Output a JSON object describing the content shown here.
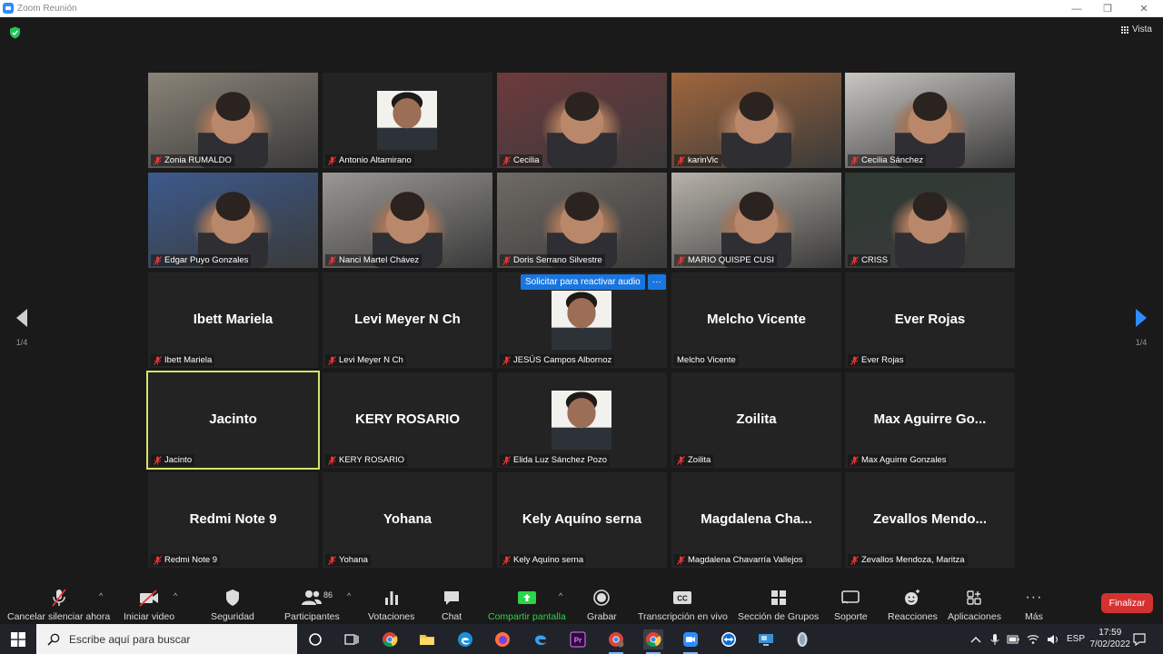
{
  "window": {
    "title": "Zoom Reunión",
    "minimize": "—",
    "maximize": "❐",
    "close": "✕"
  },
  "header": {
    "view_label": "Vista"
  },
  "pager": {
    "left_label": "1/4",
    "right_label": "1/4"
  },
  "reactivate_audio": {
    "label": "Solicitar para reactivar audio",
    "more": "···"
  },
  "tiles": [
    {
      "name": "Zonia RUMALDO",
      "big": "",
      "kind": "video",
      "muted": true,
      "bg": "#8a8478"
    },
    {
      "name": "Antonio Altamirano",
      "big": "",
      "kind": "photo",
      "muted": true,
      "bg": "#232323"
    },
    {
      "name": "Cecilia",
      "big": "",
      "kind": "video",
      "muted": true,
      "bg": "#6e3a3d"
    },
    {
      "name": "karinVic",
      "big": "",
      "kind": "video",
      "muted": true,
      "bg": "#a0663c"
    },
    {
      "name": "Cecilia Sánchez",
      "big": "",
      "kind": "video",
      "muted": true,
      "bg": "#c9c6c2"
    },
    {
      "name": "Edgar Puyo Gonzales",
      "big": "",
      "kind": "video",
      "muted": true,
      "bg": "#3c5a8c"
    },
    {
      "name": "Nanci Martel Chávez",
      "big": "",
      "kind": "video",
      "muted": true,
      "bg": "#9a9894"
    },
    {
      "name": "Doris Serrano Silvestre",
      "big": "",
      "kind": "video",
      "muted": true,
      "bg": "#6f6a64"
    },
    {
      "name": "MARIO QUISPE CUSI",
      "big": "",
      "kind": "video",
      "muted": true,
      "bg": "#b7b2aa"
    },
    {
      "name": "CRISS",
      "big": "",
      "kind": "video",
      "muted": true,
      "bg": "#2f3a34"
    },
    {
      "name": "Ibett Mariela",
      "big": "Ibett Mariela",
      "kind": "name",
      "muted": true
    },
    {
      "name": "Levi Meyer N Ch",
      "big": "Levi Meyer N Ch",
      "kind": "name",
      "muted": true
    },
    {
      "name": "JESÚS Campos Albornoz",
      "big": "",
      "kind": "photo",
      "muted": true
    },
    {
      "name": "Melcho Vicente",
      "big": "Melcho Vicente",
      "kind": "name",
      "muted": false
    },
    {
      "name": "Ever Rojas",
      "big": "Ever Rojas",
      "kind": "name",
      "muted": true
    },
    {
      "name": "Jacinto",
      "big": "Jacinto",
      "kind": "name",
      "muted": true,
      "active": true
    },
    {
      "name": "KERY ROSARIO",
      "big": "KERY ROSARIO",
      "kind": "name",
      "muted": true
    },
    {
      "name": "Elida Luz Sánchez Pozo",
      "big": "",
      "kind": "photo",
      "muted": true
    },
    {
      "name": "Zoilita",
      "big": "Zoilita",
      "kind": "name",
      "muted": true
    },
    {
      "name": "Max Aguirre Gonzales",
      "big": "Max Aguirre Go...",
      "kind": "name",
      "muted": true
    },
    {
      "name": "Redmi Note 9",
      "big": "Redmi Note 9",
      "kind": "name",
      "muted": true
    },
    {
      "name": "Yohana",
      "big": "Yohana",
      "kind": "name",
      "muted": true
    },
    {
      "name": "Kely Aquíno serna",
      "big": "Kely Aquíno serna",
      "kind": "name",
      "muted": true
    },
    {
      "name": "Magdalena Chavarría Vallejos",
      "big": "Magdalena  Cha...",
      "kind": "name",
      "muted": true
    },
    {
      "name": "Zevallos Mendoza, Maritza",
      "big": "Zevallos  Mendo...",
      "kind": "name",
      "muted": true
    }
  ],
  "toolbar": {
    "unmute": "Cancelar silenciar ahora",
    "video": "Iniciar video",
    "security": "Seguridad",
    "participants": "Participantes",
    "participants_count": "86",
    "polls": "Votaciones",
    "chat": "Chat",
    "share": "Compartir pantalla",
    "record": "Grabar",
    "transcription": "Transcripción en vivo",
    "breakout": "Sección de Grupos",
    "support": "Soporte",
    "reactions": "Reacciones",
    "apps": "Aplicaciones",
    "more": "Más",
    "end": "Finalizar",
    "caret": "^",
    "cc": "CC",
    "more_dots": "···",
    "share_color": "#2bd44a",
    "end_color": "#d63131"
  },
  "taskbar": {
    "search_placeholder": "Escribe aquí para buscar",
    "lang": "ESP",
    "time": "17:59",
    "date": "7/02/2022",
    "premiere": "Pr"
  }
}
